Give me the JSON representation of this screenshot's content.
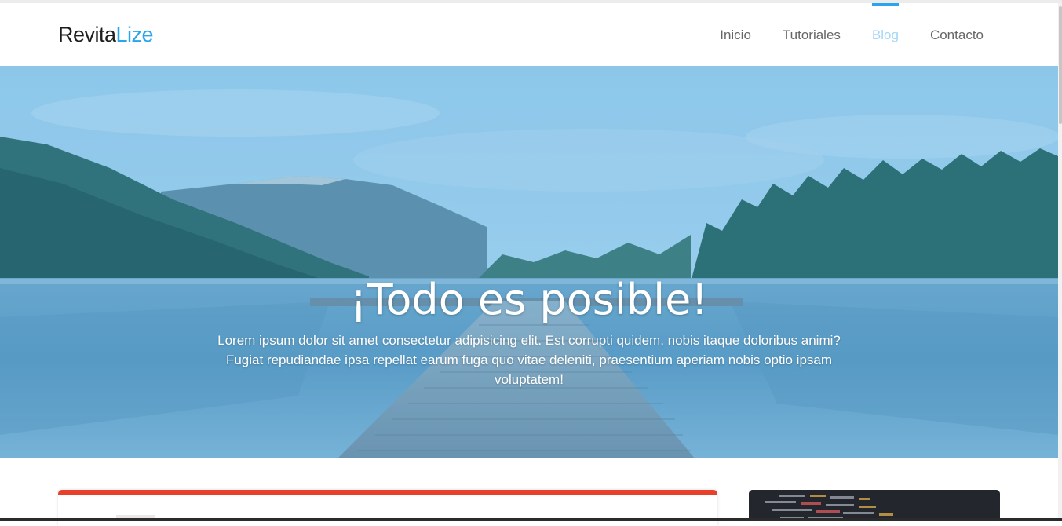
{
  "brand": {
    "part1": "Revita",
    "part2": "Lize",
    "color_part2": "#2aa4ec"
  },
  "nav": {
    "items": [
      {
        "label": "Inicio",
        "active": false
      },
      {
        "label": "Tutoriales",
        "active": false
      },
      {
        "label": "Blog",
        "active": true
      },
      {
        "label": "Contacto",
        "active": false
      }
    ],
    "active_color": "#2aa4ec"
  },
  "hero": {
    "title": "¡Todo es posible!",
    "text": "Lorem ipsum dolor sit amet consectetur adipisicing elit. Est corrupti quidem, nobis itaque doloribus animi? Fugiat repudiandae ipsa repellat earum fuga quo vitae deleniti, praesentium aperiam nobis optio ipsam voluptatem!",
    "image": "lake-pier-with-mountains-and-forest"
  },
  "cards": {
    "left_accent_color": "#e8402a",
    "right_image": "code-editor-screenshot"
  }
}
